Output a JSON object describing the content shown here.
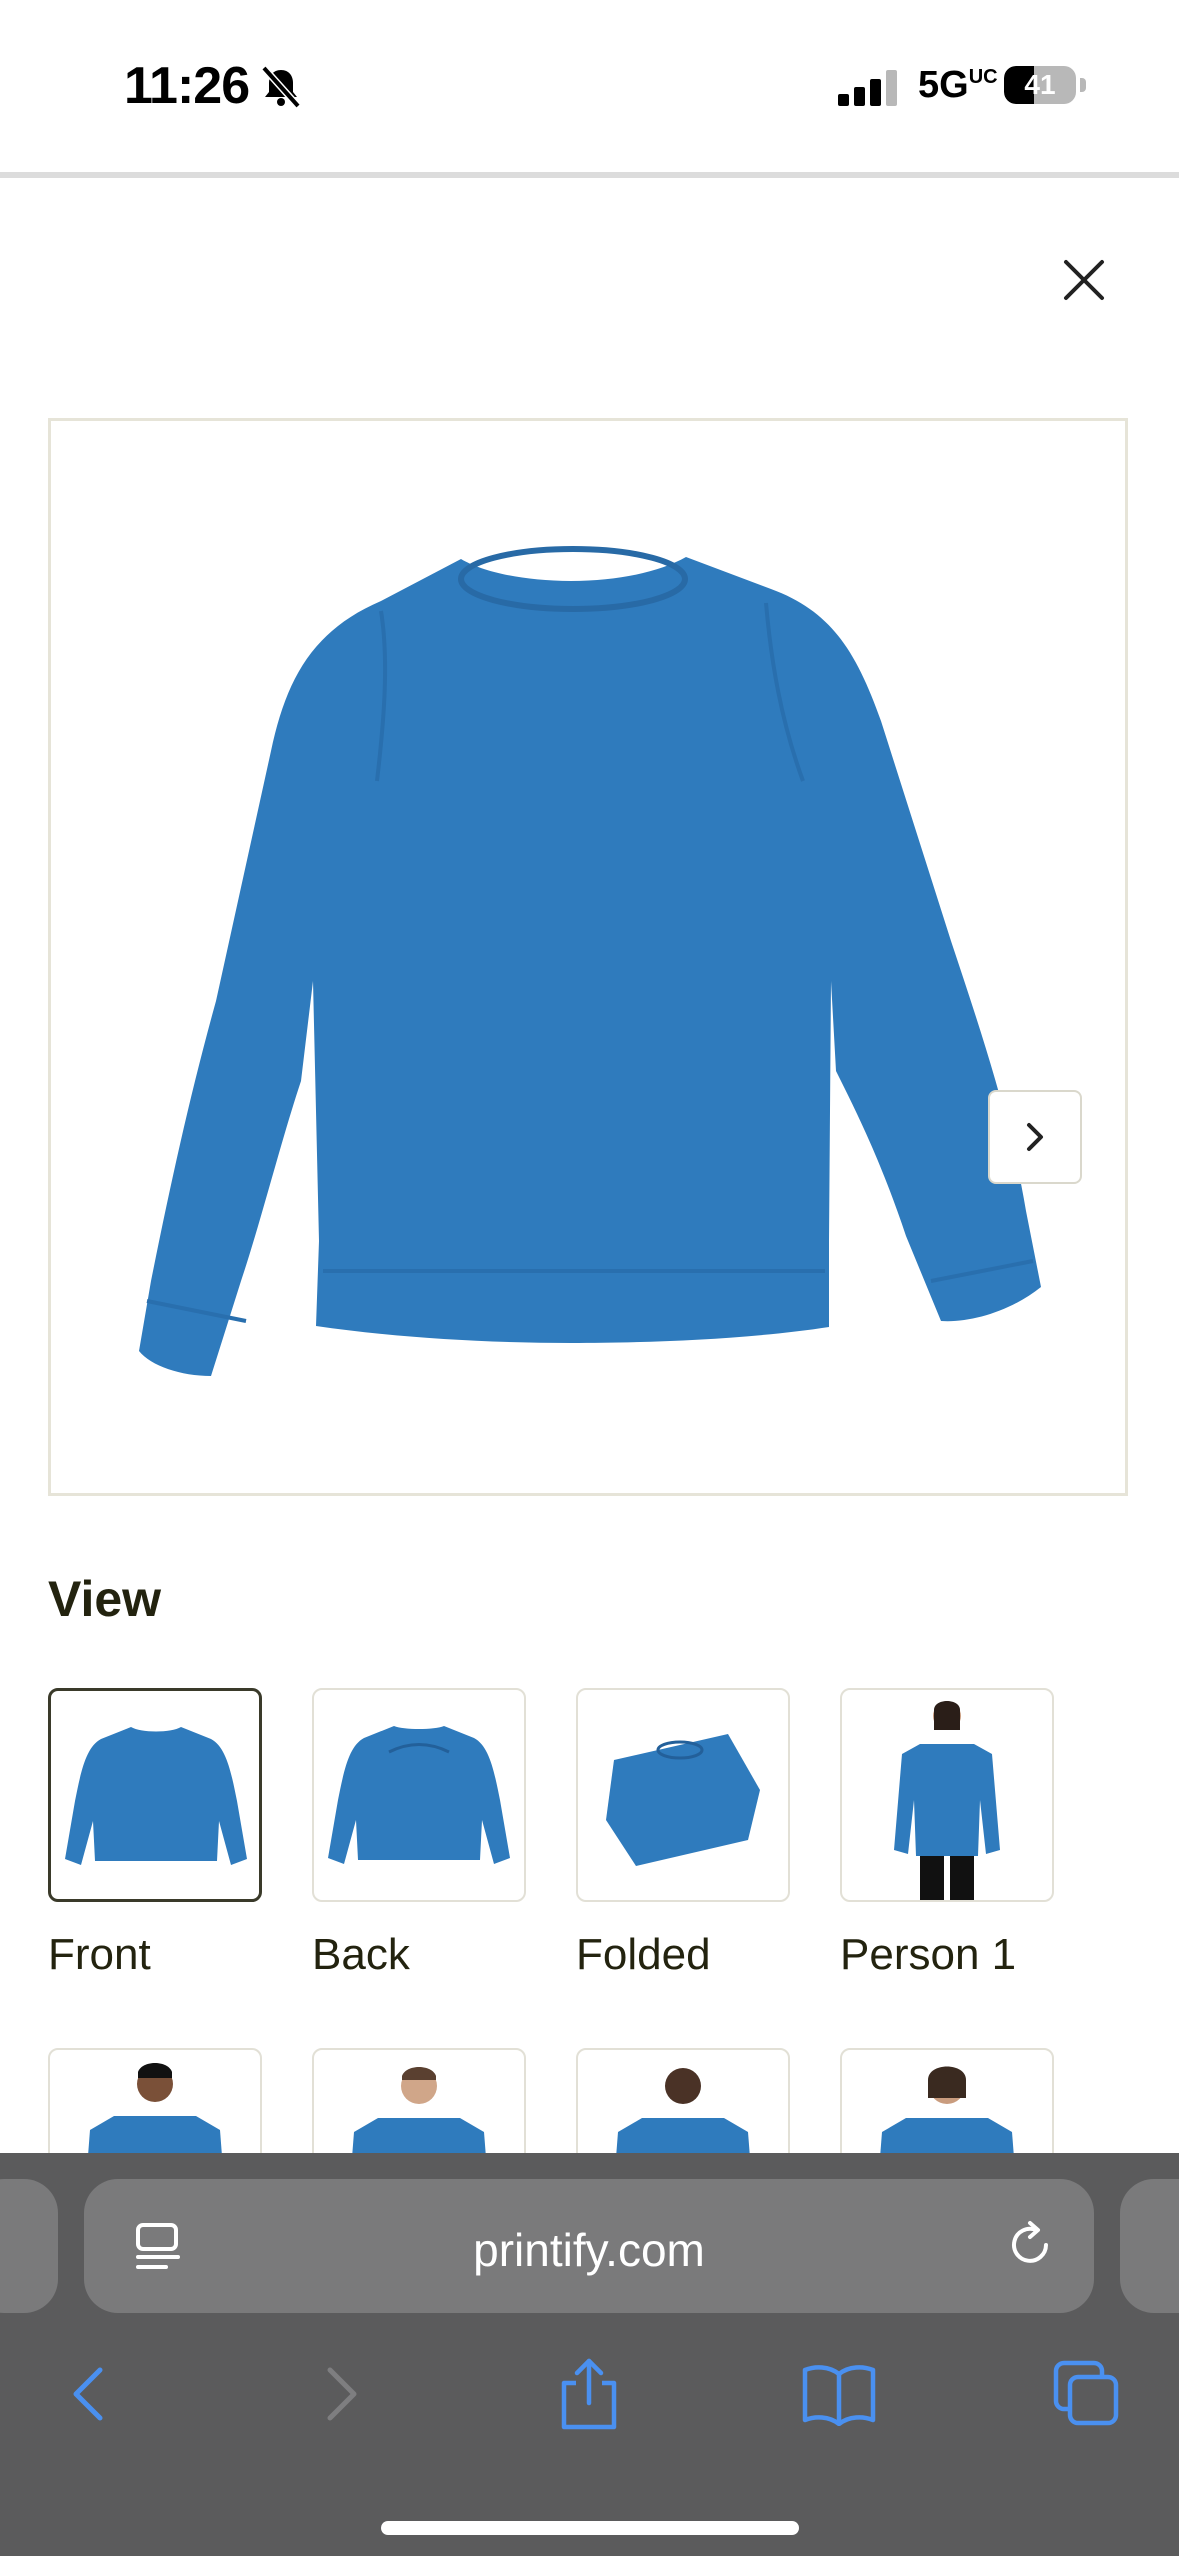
{
  "status_bar": {
    "time": "11:26",
    "network": "5G",
    "network_badge": "UC",
    "battery_percent": "41",
    "battery_level": 0.41
  },
  "modal": {
    "close_icon": "close-icon",
    "next_icon": "chevron-right-icon",
    "product_color": "#2f7bbd",
    "view_title": "View",
    "views": [
      {
        "label": "Front",
        "selected": true
      },
      {
        "label": "Back",
        "selected": false
      },
      {
        "label": "Folded",
        "selected": false
      },
      {
        "label": "Person 1",
        "selected": false
      }
    ]
  },
  "browser": {
    "url": "printify.com",
    "accent_color": "#4a90f0"
  }
}
